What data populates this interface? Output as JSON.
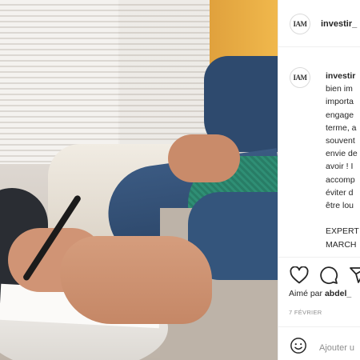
{
  "post": {
    "username": "investir_",
    "caption": {
      "username": "investir",
      "lines": [
        "bien im",
        "importa",
        "engage",
        "terme, a",
        "souvent",
        "envie de",
        "avoir ! I",
        "accomp",
        "éviter d",
        "être lou",
        "",
        "EXPERT",
        "MARCH"
      ]
    },
    "likes": {
      "prefix": "Aimé par",
      "user": "abdel_"
    },
    "date": "7 FÉVRIER",
    "comment_placeholder": "Ajouter u",
    "avatar_logo": "IAM"
  },
  "icons": {
    "like": "heart-icon",
    "comment": "comment-icon",
    "share": "share-icon",
    "emoji": "emoji-icon"
  }
}
